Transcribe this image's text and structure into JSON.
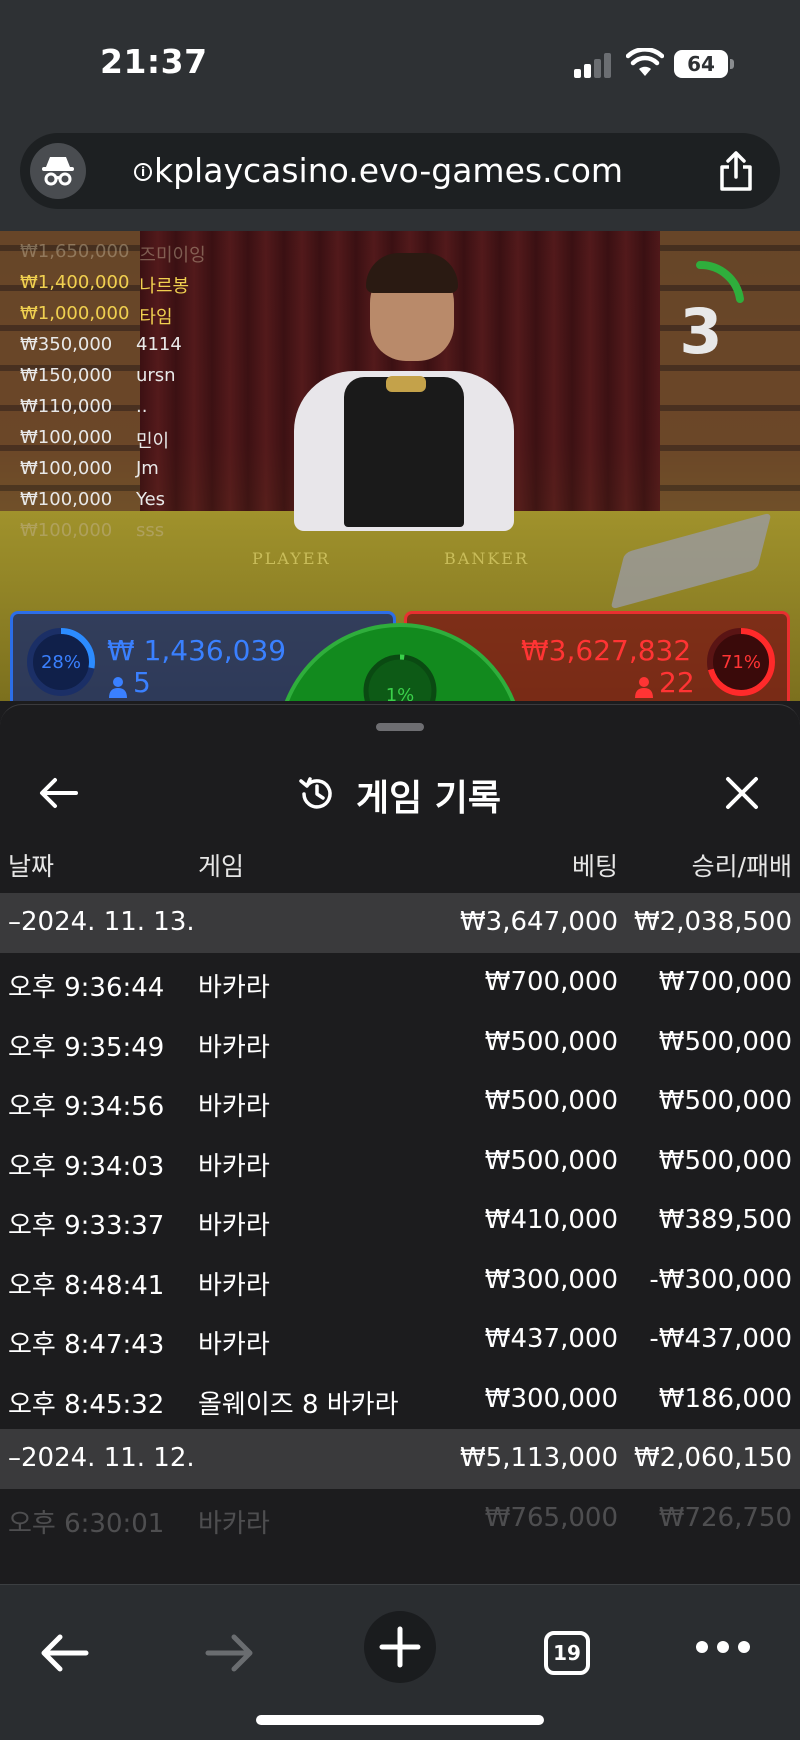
{
  "status": {
    "time": "21:37",
    "battery": "64"
  },
  "browser": {
    "url": "kplaycasino.evo-games.com",
    "tab_count": "19"
  },
  "game": {
    "countdown": "3",
    "table_labels": {
      "player": "PLAYER",
      "banker": "BANKER"
    },
    "bettors": [
      {
        "amount": "₩1,650,000",
        "name": "즈미이잉",
        "style": "faded"
      },
      {
        "amount": "₩1,400,000",
        "name": "나르봉",
        "style": "gold"
      },
      {
        "amount": "₩1,000,000",
        "name": "타임",
        "style": "gold"
      },
      {
        "amount": "₩350,000",
        "name": "4114",
        "style": "white"
      },
      {
        "amount": "₩150,000",
        "name": "ursn",
        "style": "white"
      },
      {
        "amount": "₩110,000",
        "name": "..",
        "style": "white"
      },
      {
        "amount": "₩100,000",
        "name": "민이",
        "style": "white"
      },
      {
        "amount": "₩100,000",
        "name": "Jm",
        "style": "white"
      },
      {
        "amount": "₩100,000",
        "name": "Yes",
        "style": "white"
      },
      {
        "amount": "₩100,000",
        "name": "sss",
        "style": "faded"
      }
    ],
    "player": {
      "percent": "28%",
      "percent_value": 0.28,
      "total": "₩ 1,436,039",
      "count": "5",
      "color": "#2c6ee8"
    },
    "banker": {
      "percent": "71%",
      "percent_value": 0.71,
      "total": "₩3,627,832",
      "count": "22",
      "color": "#e83030"
    },
    "tie": {
      "percent": "1%",
      "percent_value": 0.01,
      "color": "#2fae3c"
    }
  },
  "history": {
    "title": "게임 기록",
    "columns": {
      "date": "날짜",
      "game": "게임",
      "bet": "베팅",
      "result": "승리/패배"
    },
    "groups": [
      {
        "date": "–2024. 11. 13.",
        "bet_total": "₩3,647,000",
        "result_total": "₩2,038,500",
        "rows": [
          {
            "time": "오후 9:36:44",
            "game": "바카라",
            "bet": "₩700,000",
            "result": "₩700,000"
          },
          {
            "time": "오후 9:35:49",
            "game": "바카라",
            "bet": "₩500,000",
            "result": "₩500,000"
          },
          {
            "time": "오후 9:34:56",
            "game": "바카라",
            "bet": "₩500,000",
            "result": "₩500,000"
          },
          {
            "time": "오후 9:34:03",
            "game": "바카라",
            "bet": "₩500,000",
            "result": "₩500,000"
          },
          {
            "time": "오후 9:33:37",
            "game": "바카라",
            "bet": "₩410,000",
            "result": "₩389,500"
          },
          {
            "time": "오후 8:48:41",
            "game": "바카라",
            "bet": "₩300,000",
            "result": "-₩300,000"
          },
          {
            "time": "오후 8:47:43",
            "game": "바카라",
            "bet": "₩437,000",
            "result": "-₩437,000"
          },
          {
            "time": "오후 8:45:32",
            "game": "올웨이즈 8 바카라",
            "bet": "₩300,000",
            "result": "₩186,000"
          }
        ]
      },
      {
        "date": "–2024. 11. 12.",
        "bet_total": "₩5,113,000",
        "result_total": "₩2,060,150",
        "rows": [
          {
            "time": "오후 6:30:01",
            "game": "바카라",
            "bet": "₩765,000",
            "result": "₩726,750"
          }
        ]
      }
    ]
  }
}
